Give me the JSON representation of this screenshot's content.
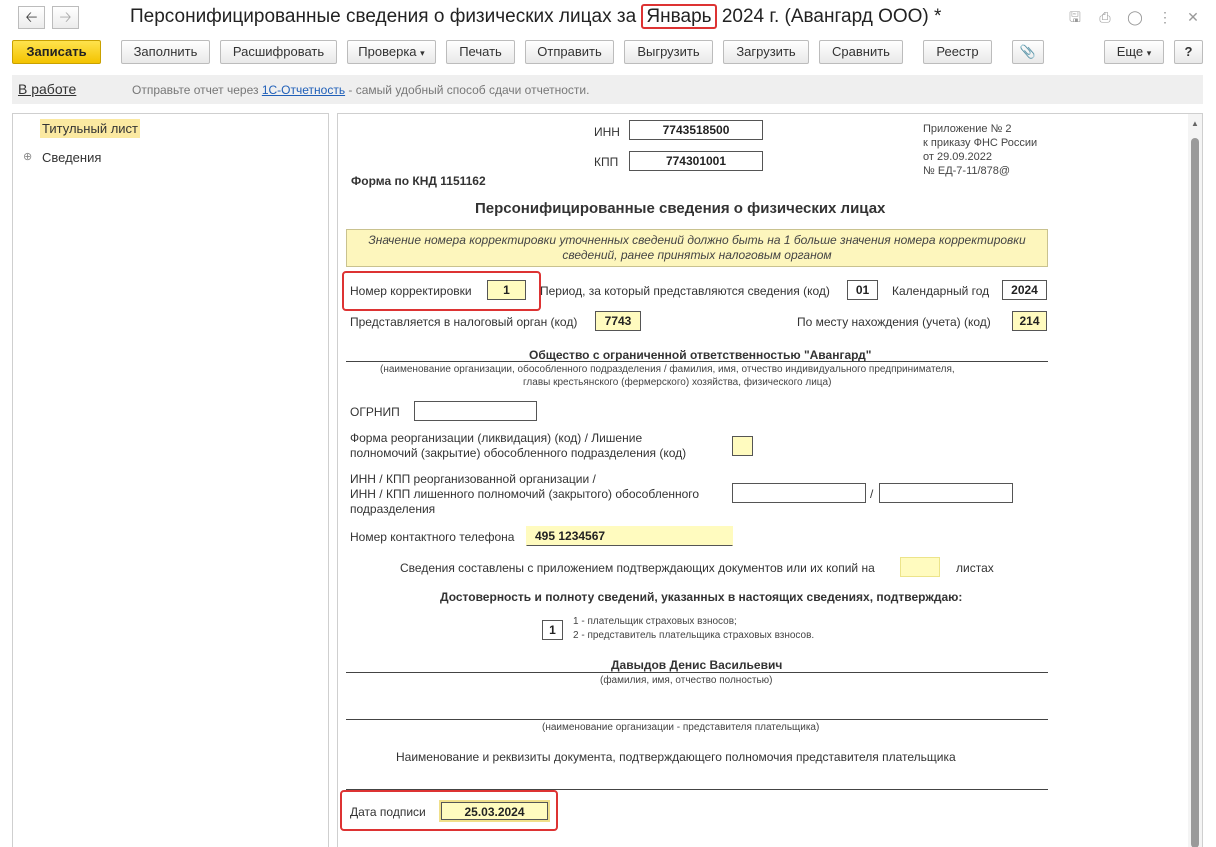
{
  "window": {
    "title_prefix": "Персонифицированные сведения о физических лицах за ",
    "title_month": "Январь",
    "title_suffix": " 2024 г. (Авангард ООО) *",
    "back_icon": "arrow-left-icon",
    "forward_icon": "arrow-right-icon",
    "icons": [
      "save-icon",
      "print-icon",
      "preview-icon",
      "menu-icon",
      "close-icon"
    ]
  },
  "toolbar": {
    "write": "Записать",
    "fill": "Заполнить",
    "decode": "Расшифровать",
    "check": "Проверка",
    "print": "Печать",
    "send": "Отправить",
    "upload": "Выгрузить",
    "load": "Загрузить",
    "compare": "Сравнить",
    "registry": "Реестр",
    "more": "Еще",
    "help": "?"
  },
  "infobar": {
    "status": "В работе",
    "msg_before": "Отправьте отчет через ",
    "msg_link": "1С-Отчетность",
    "msg_after": " - самый удобный способ сдачи отчетности."
  },
  "tree": {
    "items": [
      {
        "label": "Титульный лист"
      },
      {
        "label": "Сведения"
      }
    ]
  },
  "form": {
    "inn_label": "ИНН",
    "inn": "7743518500",
    "kpp_label": "КПП",
    "kpp": "774301001",
    "knd": "Форма по КНД 1151162",
    "appendix": [
      "Приложение № 2",
      "к приказу ФНС России",
      "от 29.09.2022",
      "№ ЕД-7-11/878@"
    ],
    "heading": "Персонифицированные сведения о физических лицах",
    "notice": "Значение номера корректировки уточненных сведений должно быть на 1 больше значения номера корректировки сведений, ранее принятых налоговым органом",
    "correction_label": "Номер корректировки",
    "correction": "1",
    "period_label": "Период, за который представляются сведения (код)",
    "period": "01",
    "year_label": "Календарный год",
    "year": "2024",
    "tax_org_label": "Представляется в налоговый орган (код)",
    "tax_org": "7743",
    "location_label": "По месту нахождения (учета) (код)",
    "location": "214",
    "org_name": "Общество с ограниченной ответственностью \"Авангард\"",
    "org_name_hint1": "(наименование организации, обособленного подразделения / фамилия, имя, отчество индивидуального предпринимателя,",
    "org_name_hint2": "главы крестьянского (фермерского) хозяйства, физического лица)",
    "ogrnip_label": "ОГРНИП",
    "ogrnip": "",
    "reorg_label1": "Форма реорганизации (ликвидация) (код) / Лишение",
    "reorg_label2": "полномочий (закрытие) обособленного подразделения (код)",
    "reorg_inn_label1": "ИНН / КПП реорганизованной организации /",
    "reorg_inn_label2": "ИНН / КПП лишенного полномочий (закрытого) обособленного",
    "reorg_inn_label3": "подразделения",
    "slash": "/",
    "phone_label": "Номер контактного телефона",
    "phone": "495 1234567",
    "attach_label": "Сведения составлены с приложением подтверждающих документов или их копий на",
    "attach_suffix": "листах",
    "confirm_heading": "Достоверность и полноту сведений, указанных в настоящих сведениях, подтверждаю:",
    "confirm_code": "1",
    "confirm_opt1": "1 - плательщик страховых взносов;",
    "confirm_opt2": "2 - представитель плательщика страховых взносов.",
    "signer": "Давыдов Денис Васильевич",
    "signer_hint": "(фамилия, имя, отчество полностью)",
    "rep_org_hint": "(наименование организации - представителя плательщика)",
    "doc_label": "Наименование и реквизиты документа, подтверждающего полномочия представителя плательщика",
    "date_label": "Дата подписи",
    "date": "25.03.2024"
  }
}
